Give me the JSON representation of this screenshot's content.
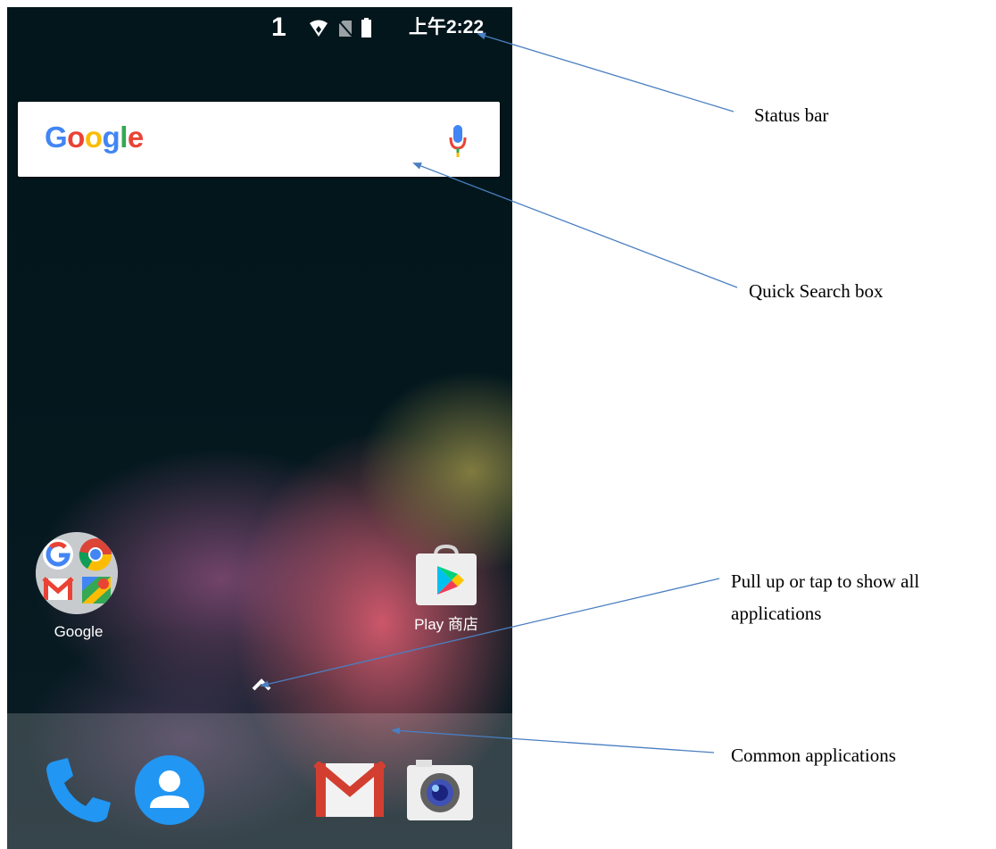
{
  "status_bar": {
    "notification_count": "1",
    "time": "上午2:22",
    "icons": [
      "wifi-icon",
      "no-sim-icon",
      "battery-icon"
    ]
  },
  "search": {
    "logo_letters": [
      {
        "char": "G",
        "color": "#4285F4"
      },
      {
        "char": "o",
        "color": "#EA4335"
      },
      {
        "char": "o",
        "color": "#FBBC05"
      },
      {
        "char": "g",
        "color": "#4285F4"
      },
      {
        "char": "l",
        "color": "#34A853"
      },
      {
        "char": "e",
        "color": "#EA4335"
      }
    ],
    "mic_icon": "mic-icon"
  },
  "home_apps": [
    {
      "label": "Google",
      "icon": "google-folder-icon"
    },
    {
      "label": "Play 商店",
      "icon": "play-store-icon"
    }
  ],
  "all_apps_icon": "chevron-up-icon",
  "dock": {
    "apps": [
      "phone-icon",
      "contacts-icon",
      "gmail-icon",
      "camera-icon"
    ]
  },
  "annotations": {
    "status_bar": "Status bar",
    "quick_search": "Quick Search box",
    "pull_up_line1": "Pull up or tap to show all",
    "pull_up_line2": "applications",
    "common_apps": "Common applications"
  },
  "colors": {
    "arrow": "#4a7fc1",
    "wallpaper_dark": "#02171d",
    "google_blue": "#4285F4",
    "google_red": "#EA4335",
    "google_yellow": "#FBBC05",
    "google_green": "#34A853"
  }
}
